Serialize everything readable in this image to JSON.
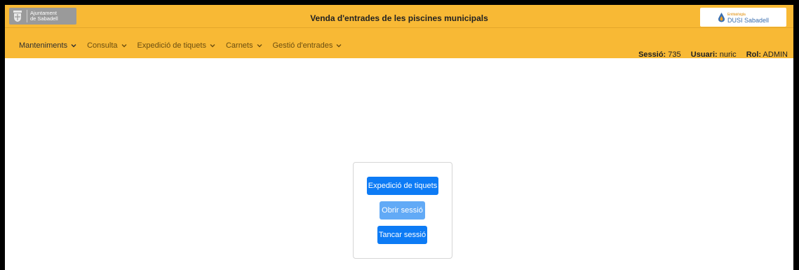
{
  "header": {
    "logo_left": {
      "line1": "Ajuntament",
      "line2": "de Sabadell"
    },
    "title": "Venda d'entrades de les piscines municipals",
    "logo_right": {
      "tagline": "Entitat/sigla",
      "name": "DUSI Sabadell"
    }
  },
  "nav": {
    "items": [
      {
        "label": "Manteniments"
      },
      {
        "label": "Consulta"
      },
      {
        "label": "Expedició de tiquets"
      },
      {
        "label": "Carnets"
      },
      {
        "label": "Gestió d'entrades"
      }
    ]
  },
  "session": {
    "sessio_label": "Sessió:",
    "sessio_value": "735",
    "usuari_label": "Usuari:",
    "usuari_value": "nuric",
    "rol_label": "Rol:",
    "rol_value": "ADMIN"
  },
  "actions": {
    "expedicio_label": "Expedició de tiquets",
    "obrir_label": "Obrir sessió",
    "tancar_label": "Tancar sessió"
  },
  "colors": {
    "header_bg": "#f8b935",
    "primary_button": "#0d7bf5",
    "disabled_button": "#62aaf6"
  }
}
